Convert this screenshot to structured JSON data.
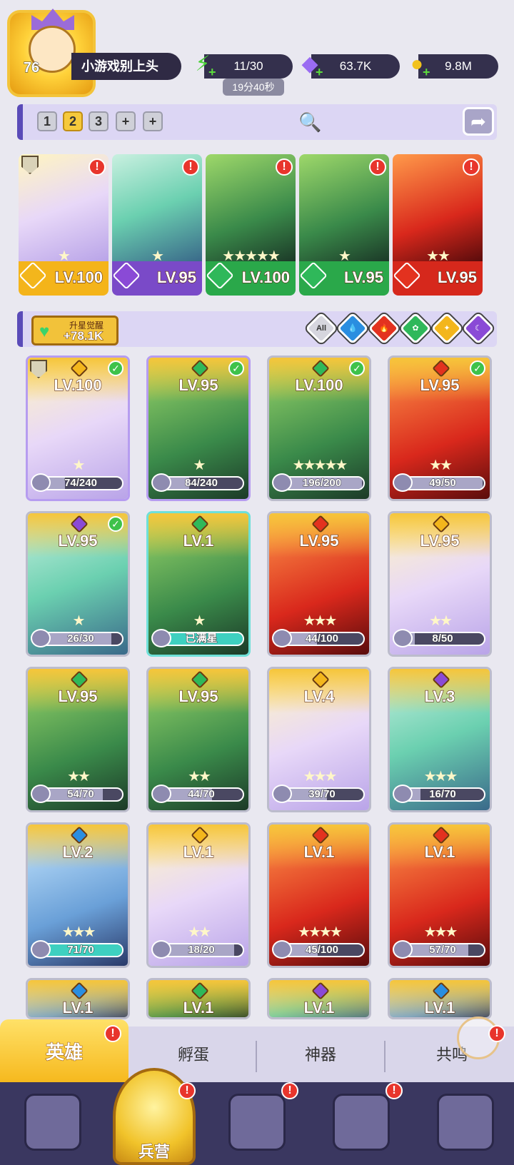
{
  "player": {
    "level": "76",
    "name": "小游戏别上头"
  },
  "resources": [
    {
      "name": "stamina",
      "icon": "lightning-icon",
      "value": "11/30",
      "timer": "19分40秒",
      "color": "#4bd13a"
    },
    {
      "name": "gems",
      "icon": "diamond-icon",
      "value": "63.7K",
      "color": "#8a5cf2"
    },
    {
      "name": "gold",
      "icon": "coin-icon",
      "value": "9.8M",
      "color": "#f2c21c"
    }
  ],
  "team_tabs": [
    "1",
    "2",
    "3",
    "+",
    "+"
  ],
  "team_selected": "2",
  "team": [
    {
      "level": "LV.100",
      "element": "light",
      "stars": "★",
      "badge": "!"
    },
    {
      "level": "LV.95",
      "element": "dark",
      "stars": "★",
      "badge": "!"
    },
    {
      "level": "LV.100",
      "element": "nature",
      "stars": "★★★★★",
      "badge": "!"
    },
    {
      "level": "LV.95",
      "element": "nature",
      "stars": "★",
      "badge": "!"
    },
    {
      "level": "LV.95",
      "element": "fire",
      "stars": "★★",
      "badge": "!"
    }
  ],
  "awaken": {
    "label": "升星觉醒",
    "value": "+78.1K"
  },
  "filters": [
    "All",
    "water",
    "fire",
    "nature",
    "light",
    "dark"
  ],
  "filter_all_label": "All",
  "heroes": [
    {
      "level": "LV.100",
      "element": "light",
      "progress": "74/240",
      "fraction": 0.31,
      "stars": "★",
      "owned_check": true
    },
    {
      "level": "LV.95",
      "element": "nature",
      "progress": "84/240",
      "fraction": 0.35,
      "stars": "★",
      "owned_check": true
    },
    {
      "level": "LV.100",
      "element": "nature",
      "progress": "196/200",
      "fraction": 0.98,
      "stars": "★★★★★",
      "owned_check": true
    },
    {
      "level": "LV.95",
      "element": "fire",
      "progress": "49/50",
      "fraction": 0.98,
      "stars": "★★",
      "owned_check": true
    },
    {
      "level": "LV.95",
      "element": "dark",
      "progress": "26/30",
      "fraction": 0.87,
      "stars": "★",
      "owned_check": true
    },
    {
      "level": "LV.1",
      "element": "nature",
      "progress": "已满星",
      "fraction": 1.0,
      "stars": "★",
      "owned_check": false
    },
    {
      "level": "LV.95",
      "element": "fire",
      "progress": "44/100",
      "fraction": 0.44,
      "stars": "★★★",
      "owned_check": false
    },
    {
      "level": "LV.95",
      "element": "light",
      "progress": "8/50",
      "fraction": 0.16,
      "stars": "★★",
      "owned_check": false
    },
    {
      "level": "LV.95",
      "element": "nature",
      "progress": "54/70",
      "fraction": 0.77,
      "stars": "★★",
      "owned_check": false
    },
    {
      "level": "LV.95",
      "element": "nature",
      "progress": "44/70",
      "fraction": 0.63,
      "stars": "★★",
      "owned_check": false
    },
    {
      "level": "LV.4",
      "element": "light",
      "progress": "39/70",
      "fraction": 0.56,
      "stars": "★★★",
      "owned_check": false
    },
    {
      "level": "LV.3",
      "element": "dark",
      "progress": "16/70",
      "fraction": 0.23,
      "stars": "★★★",
      "owned_check": false
    },
    {
      "level": "LV.2",
      "element": "water",
      "progress": "71/70",
      "fraction": 1.0,
      "stars": "★★★",
      "owned_check": false
    },
    {
      "level": "LV.1",
      "element": "light",
      "progress": "18/20",
      "fraction": 0.9,
      "stars": "★★",
      "owned_check": false
    },
    {
      "level": "LV.1",
      "element": "fire",
      "progress": "45/100",
      "fraction": 0.45,
      "stars": "★★★★",
      "owned_check": false
    },
    {
      "level": "LV.1",
      "element": "fire",
      "progress": "57/70",
      "fraction": 0.81,
      "stars": "★★★",
      "owned_check": false
    },
    {
      "level": "LV.1",
      "element": "water",
      "progress": "",
      "fraction": 0,
      "stars": "",
      "owned_check": false
    },
    {
      "level": "LV.1",
      "element": "nature",
      "progress": "",
      "fraction": 0,
      "stars": "",
      "owned_check": false
    },
    {
      "level": "LV.1",
      "element": "dark",
      "progress": "",
      "fraction": 0,
      "stars": "",
      "owned_check": false
    },
    {
      "level": "LV.1",
      "element": "water",
      "progress": "",
      "fraction": 0,
      "stars": "",
      "owned_check": false
    }
  ],
  "tabs": {
    "hero": "英雄",
    "hatch": "孵蛋",
    "artifact": "神器",
    "resonance": "共鸣",
    "badge": "!"
  },
  "bottom_nav": {
    "barracks": "兵营",
    "badge": "!"
  },
  "element_colors": {
    "light": "#f3b61c",
    "dark": "#8a4ad6",
    "nature": "#2fb85a",
    "fire": "#e3321f",
    "water": "#2a8ee0"
  }
}
